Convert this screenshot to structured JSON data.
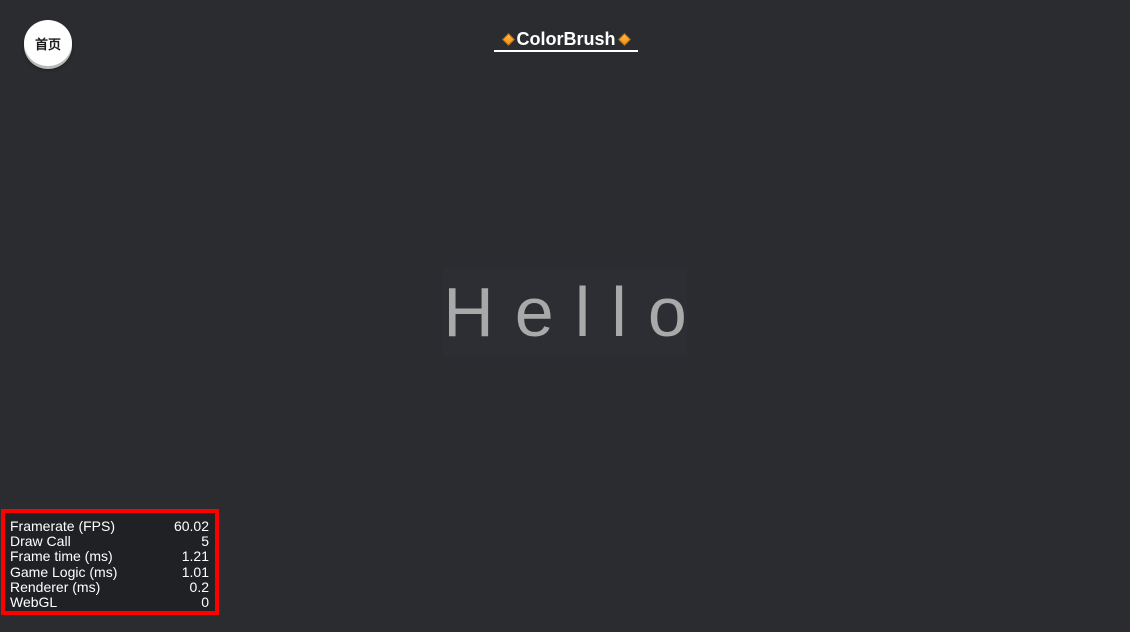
{
  "home_button": {
    "label": "首页"
  },
  "header": {
    "title": "ColorBrush",
    "icon": "orange-diamond-icon"
  },
  "canvas": {
    "text": "Hello"
  },
  "stats": {
    "rows": [
      {
        "label": "Framerate (FPS)",
        "value": "60.02"
      },
      {
        "label": "Draw Call",
        "value": "5"
      },
      {
        "label": "Frame time (ms)",
        "value": "1.21"
      },
      {
        "label": "Game Logic (ms)",
        "value": "1.01"
      },
      {
        "label": "Renderer (ms)",
        "value": "0.2"
      },
      {
        "label": "WebGL",
        "value": "0"
      }
    ]
  },
  "colors": {
    "background": "#2a2c30",
    "highlight_border": "#ff0000",
    "accent": "#f08a10",
    "hello_text": "#a9a9a9"
  }
}
